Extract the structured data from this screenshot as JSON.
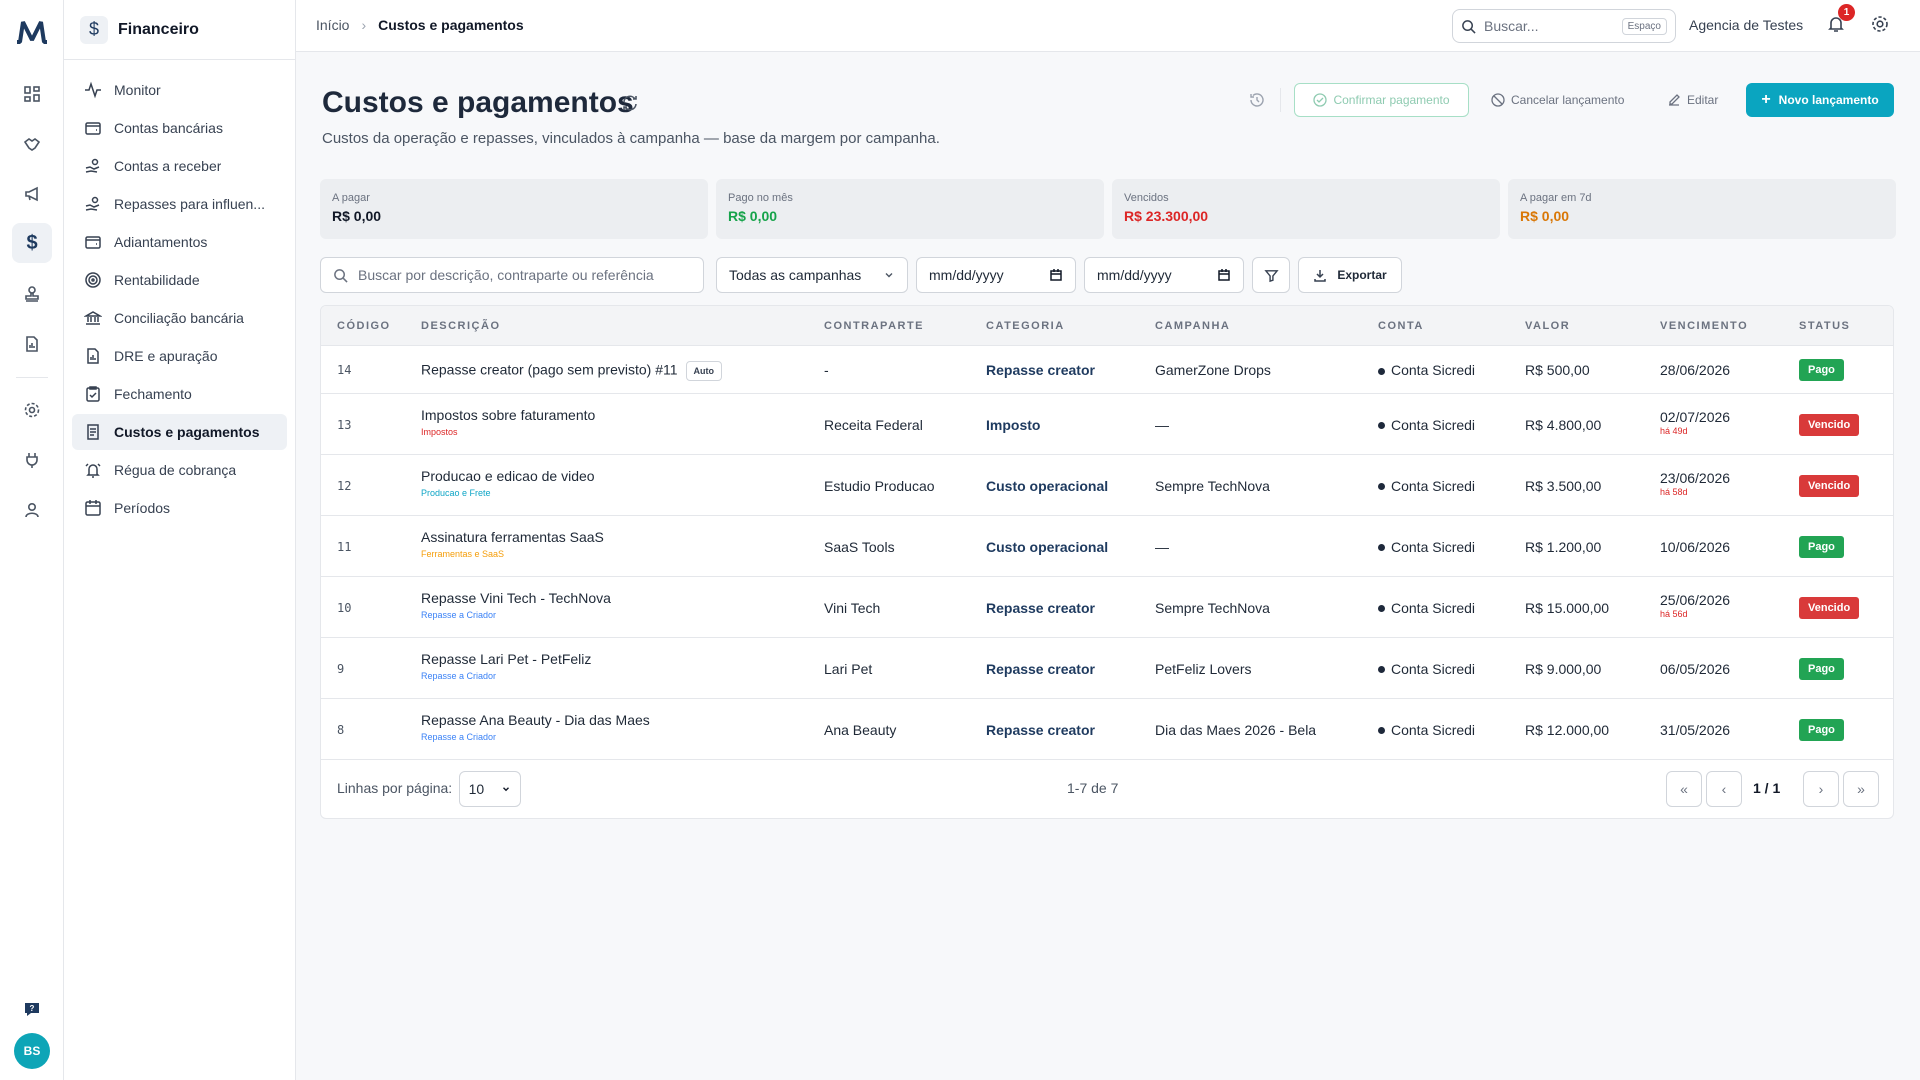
{
  "sidebar": {
    "module_title": "Financeiro",
    "items": [
      {
        "label": "Monitor",
        "icon": "activity-icon"
      },
      {
        "label": "Contas bancárias",
        "icon": "wallet-icon"
      },
      {
        "label": "Contas a receber",
        "icon": "hand-coins-icon"
      },
      {
        "label": "Repasses para influen...",
        "icon": "hand-coins-icon"
      },
      {
        "label": "Adiantamentos",
        "icon": "wallet-icon"
      },
      {
        "label": "Rentabilidade",
        "icon": "target-icon"
      },
      {
        "label": "Conciliação bancária",
        "icon": "bank-icon"
      },
      {
        "label": "DRE e apuração",
        "icon": "file-chart-icon"
      },
      {
        "label": "Fechamento",
        "icon": "clipboard-check-icon"
      },
      {
        "label": "Custos e pagamentos",
        "icon": "receipt-icon",
        "active": true
      },
      {
        "label": "Régua de cobrança",
        "icon": "bell-ring-icon"
      },
      {
        "label": "Períodos",
        "icon": "calendar-icon"
      }
    ]
  },
  "user": {
    "initials": "BS"
  },
  "topbar": {
    "breadcrumb_home": "Início",
    "breadcrumb_current": "Custos e pagamentos",
    "search_placeholder": "Buscar...",
    "search_shortcut": "Espaço",
    "org_name": "Agencia de Testes",
    "notification_count": "1"
  },
  "page": {
    "title": "Custos e pagamentos",
    "subtitle": "Custos da operação e repasses, vinculados à campanha — base da margem por campanha."
  },
  "actions": {
    "confirm": "Confirmar pagamento",
    "cancel": "Cancelar lançamento",
    "edit": "Editar",
    "new": "Novo lançamento"
  },
  "kpis": [
    {
      "label": "A pagar",
      "value": "R$ 0,00",
      "color": "#111827"
    },
    {
      "label": "Pago no mês",
      "value": "R$ 0,00",
      "color": "#16a34a"
    },
    {
      "label": "Vencidos",
      "value": "R$ 23.300,00",
      "color": "#dc2626"
    },
    {
      "label": "A pagar em 7d",
      "value": "R$ 0,00",
      "color": "#d97706"
    }
  ],
  "filters": {
    "search_placeholder": "Buscar por descrição, contraparte ou referência",
    "campaign": "Todas as campanhas",
    "date_from": "mm/dd/yyyy",
    "date_to": "mm/dd/yyyy",
    "export": "Exportar"
  },
  "table": {
    "headers": [
      "CÓDIGO",
      "DESCRIÇÃO",
      "CONTRAPARTE",
      "CATEGORIA",
      "CAMPANHA",
      "CONTA",
      "VALOR",
      "VENCIMENTO",
      "STATUS"
    ],
    "rows": [
      {
        "code": "14",
        "desc": "Repasse creator (pago sem previsto) #11",
        "auto": "Auto",
        "tag": "",
        "tag_color": "",
        "party": "-",
        "category": "Repasse creator",
        "campaign": "GamerZone Drops",
        "account": "Conta Sicredi",
        "value": "R$ 500,00",
        "due": "28/06/2026",
        "late": "",
        "status": "Pago",
        "status_kind": "pago"
      },
      {
        "code": "13",
        "desc": "Impostos sobre faturamento",
        "auto": "",
        "tag": "Impostos",
        "tag_color": "#dc2626",
        "party": "Receita Federal",
        "category": "Imposto",
        "campaign": "—",
        "account": "Conta Sicredi",
        "value": "R$ 4.800,00",
        "due": "02/07/2026",
        "late": "há 49d",
        "status": "Vencido",
        "status_kind": "venc"
      },
      {
        "code": "12",
        "desc": "Producao e edicao de video",
        "auto": "",
        "tag": "Producao e Frete",
        "tag_color": "#0ea5c6",
        "party": "Estudio Producao",
        "category": "Custo operacional",
        "campaign": "Sempre TechNova",
        "account": "Conta Sicredi",
        "value": "R$ 3.500,00",
        "due": "23/06/2026",
        "late": "há 58d",
        "status": "Vencido",
        "status_kind": "venc"
      },
      {
        "code": "11",
        "desc": "Assinatura ferramentas SaaS",
        "auto": "",
        "tag": "Ferramentas e SaaS",
        "tag_color": "#f59e0b",
        "party": "SaaS Tools",
        "category": "Custo operacional",
        "campaign": "—",
        "account": "Conta Sicredi",
        "value": "R$ 1.200,00",
        "due": "10/06/2026",
        "late": "",
        "status": "Pago",
        "status_kind": "pago"
      },
      {
        "code": "10",
        "desc": "Repasse Vini Tech - TechNova",
        "auto": "",
        "tag": "Repasse a Criador",
        "tag_color": "#3b82f6",
        "party": "Vini Tech",
        "category": "Repasse creator",
        "campaign": "Sempre TechNova",
        "account": "Conta Sicredi",
        "value": "R$ 15.000,00",
        "due": "25/06/2026",
        "late": "há 56d",
        "status": "Vencido",
        "status_kind": "venc"
      },
      {
        "code": "9",
        "desc": "Repasse Lari Pet - PetFeliz",
        "auto": "",
        "tag": "Repasse a Criador",
        "tag_color": "#3b82f6",
        "party": "Lari Pet",
        "category": "Repasse creator",
        "campaign": "PetFeliz Lovers",
        "account": "Conta Sicredi",
        "value": "R$ 9.000,00",
        "due": "06/05/2026",
        "late": "",
        "status": "Pago",
        "status_kind": "pago"
      },
      {
        "code": "8",
        "desc": "Repasse Ana Beauty - Dia das Maes",
        "auto": "",
        "tag": "Repasse a Criador",
        "tag_color": "#3b82f6",
        "party": "Ana Beauty",
        "category": "Repasse creator",
        "campaign": "Dia das Maes 2026 - Bela",
        "account": "Conta Sicredi",
        "value": "R$ 12.000,00",
        "due": "31/05/2026",
        "late": "",
        "status": "Pago",
        "status_kind": "pago"
      }
    ]
  },
  "pagination": {
    "rows_label": "Linhas por página:",
    "rows_per_page": "10",
    "range": "1-7 de 7",
    "page": "1 / 1"
  }
}
